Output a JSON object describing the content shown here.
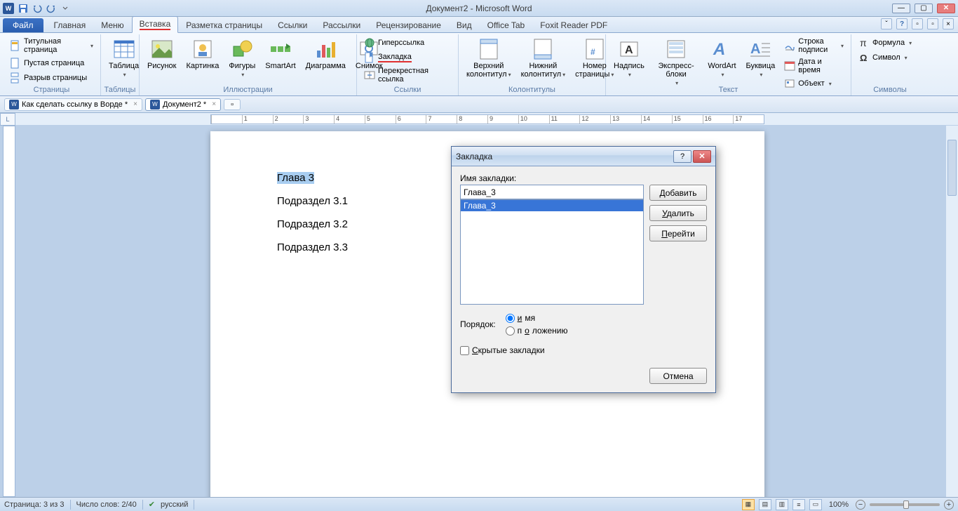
{
  "title": "Документ2 - Microsoft Word",
  "tabs": {
    "file": "Файл",
    "home": "Главная",
    "menu": "Меню",
    "insert": "Вставка",
    "layout": "Разметка страницы",
    "links": "Ссылки",
    "mailings": "Рассылки",
    "review": "Рецензирование",
    "view": "Вид",
    "officetab": "Office Tab",
    "foxit": "Foxit Reader PDF"
  },
  "ribbon": {
    "pages": {
      "title": "Страницы",
      "cover": "Титульная страница",
      "blank": "Пустая страница",
      "break": "Разрыв страницы"
    },
    "tables": {
      "title": "Таблицы",
      "table": "Таблица"
    },
    "illustrations": {
      "title": "Иллюстрации",
      "picture": "Рисунок",
      "clipart": "Картинка",
      "shapes": "Фигуры",
      "smartart": "SmartArt",
      "chart": "Диаграмма",
      "screenshot": "Снимок"
    },
    "links_grp": {
      "title": "Ссылки",
      "hyperlink": "Гиперссылка",
      "bookmark": "Закладка",
      "crossref": "Перекрестная ссылка"
    },
    "header_grp": {
      "title": "Колонтитулы",
      "header": "Верхний колонтитул",
      "footer": "Нижний колонтитул",
      "pagenum": "Номер страницы"
    },
    "text_grp": {
      "title": "Текст",
      "textbox": "Надпись",
      "quickparts": "Экспресс-блоки",
      "wordart": "WordArt",
      "dropcap": "Буквица",
      "sigline": "Строка подписи",
      "datetime": "Дата и время",
      "object": "Объект"
    },
    "symbols_grp": {
      "title": "Символы",
      "equation": "Формула",
      "symbol": "Символ"
    }
  },
  "doctabs": {
    "tab1": "Как сделать ссылку в Ворде *",
    "tab2": "Документ2 *"
  },
  "document": {
    "heading": "Глава 3",
    "p1": "Подраздел 3.1",
    "p2": "Подраздел 3.2",
    "p3": "Подраздел 3.3"
  },
  "dialog": {
    "title": "Закладка",
    "name_label": "Имя закладки:",
    "name_value": "Глава_3",
    "list_item": "Глава_3",
    "add": "Добавить",
    "delete": "Удалить",
    "goto": "Перейти",
    "sort_label": "Порядок:",
    "sort_name": "имя",
    "sort_pos": "положению",
    "hidden": "Скрытые закладки",
    "cancel": "Отмена"
  },
  "status": {
    "page": "Страница: 3 из 3",
    "words": "Число слов: 2/40",
    "lang": "русский",
    "zoom": "100%"
  },
  "ruler_corner": "L"
}
